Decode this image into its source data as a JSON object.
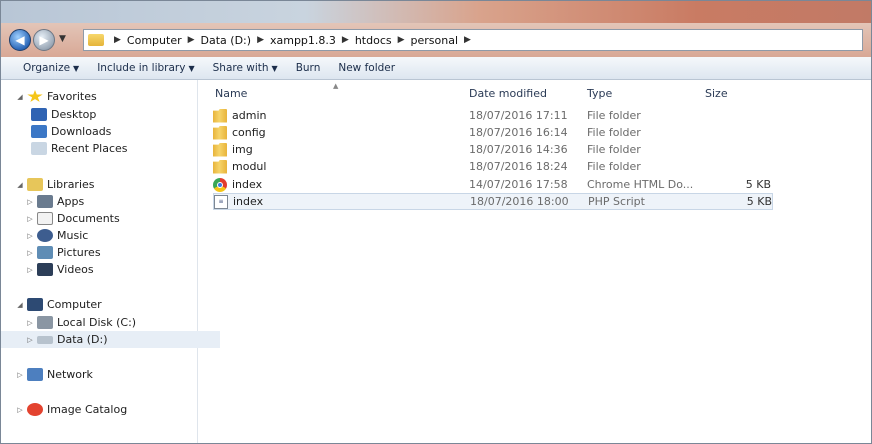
{
  "address": {
    "crumbs": [
      "Computer",
      "Data (D:)",
      "xampp1.8.3",
      "htdocs",
      "personal"
    ]
  },
  "toolbar": {
    "organize": "Organize",
    "include": "Include in library",
    "share": "Share with",
    "burn": "Burn",
    "newfolder": "New folder"
  },
  "nav": {
    "favorites": "Favorites",
    "desktop": "Desktop",
    "downloads": "Downloads",
    "recent": "Recent Places",
    "libraries": "Libraries",
    "apps": "Apps",
    "documents": "Documents",
    "music": "Music",
    "pictures": "Pictures",
    "videos": "Videos",
    "computer": "Computer",
    "localdisk": "Local Disk (C:)",
    "data": "Data (D:)",
    "network": "Network",
    "imagecatalog": "Image Catalog"
  },
  "columns": {
    "name": "Name",
    "date": "Date modified",
    "type": "Type",
    "size": "Size"
  },
  "files": [
    {
      "name": "admin",
      "date": "18/07/2016 17:11",
      "type": "File folder",
      "size": "",
      "icon": "folder-icon"
    },
    {
      "name": "config",
      "date": "18/07/2016 16:14",
      "type": "File folder",
      "size": "",
      "icon": "folder-icon"
    },
    {
      "name": "img",
      "date": "18/07/2016 14:36",
      "type": "File folder",
      "size": "",
      "icon": "folder-icon"
    },
    {
      "name": "modul",
      "date": "18/07/2016 18:24",
      "type": "File folder",
      "size": "",
      "icon": "folder-icon"
    },
    {
      "name": "index",
      "date": "14/07/2016 17:58",
      "type": "Chrome HTML Do...",
      "size": "5 KB",
      "icon": "chrome-icon"
    },
    {
      "name": "index",
      "date": "18/07/2016 18:00",
      "type": "PHP Script",
      "size": "5 KB",
      "icon": "php-icon"
    }
  ]
}
